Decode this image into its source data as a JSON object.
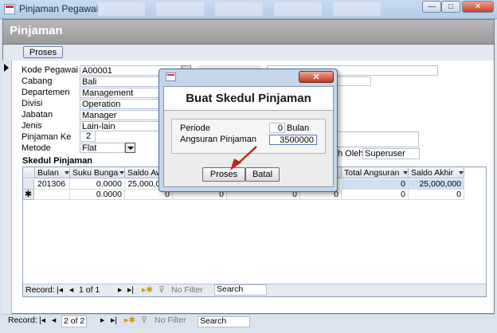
{
  "window": {
    "title": "Pinjaman Pegawai",
    "min": "—",
    "max": "□",
    "close": "✕"
  },
  "form": {
    "title": "Pinjaman",
    "proses_label": "Proses",
    "fields": [
      {
        "label": "Kode Pegawai",
        "value": "A00001"
      },
      {
        "label": "Cabang",
        "value": "Bali"
      },
      {
        "label": "Departemen",
        "value": "Management"
      },
      {
        "label": "Divisi",
        "value": "Operation"
      },
      {
        "label": "Jabatan",
        "value": "Manager"
      },
      {
        "label": "Jenis",
        "value": "Lain-lain"
      },
      {
        "label": "Pinjaman Ke",
        "value": "2"
      },
      {
        "label": "Metode",
        "value": "Flat"
      }
    ],
    "dibuat_oleh_label": "h Oleh",
    "dibuat_oleh_value": "Superuser"
  },
  "subform": {
    "title": "Skedul Pinjaman",
    "columns": [
      "Bulan",
      "Suku Bunga",
      "Saldo Awal",
      "",
      "",
      "",
      "Total Angsuran",
      "Saldo Akhir"
    ],
    "rows": [
      {
        "bulan": "201306",
        "suku_bunga": "0.0000",
        "saldo_awal": "25,000,000",
        "c4": "",
        "c5": "",
        "c6": "",
        "total_angsuran": "0",
        "saldo_akhir": "25,000,000"
      },
      {
        "bulan": "",
        "suku_bunga": "0.0000",
        "saldo_awal": "0",
        "c4": "0",
        "c5": "0",
        "c6": "0",
        "total_angsuran": "0",
        "saldo_akhir": "0"
      }
    ],
    "new_row_marker": "✱",
    "nav": {
      "record_label": "Record:",
      "position": "1 of 1",
      "filter": "No Filter",
      "search": "Search"
    }
  },
  "mainnav": {
    "record_label": "Record:",
    "position": "2 of 2",
    "filter": "No Filter",
    "search": "Search"
  },
  "dialog": {
    "title": "Buat Skedul Pinjaman",
    "periode_label": "Periode",
    "periode_value": "0",
    "periode_unit": "Bulan",
    "angsuran_label": "Angsuran Pinjaman",
    "angsuran_value": "3500000",
    "proses_label": "Proses",
    "batal_label": "Batal",
    "close": "✕"
  },
  "colors": {
    "arrow": "#c0261c",
    "highlight_row": "#cfe0f6"
  }
}
